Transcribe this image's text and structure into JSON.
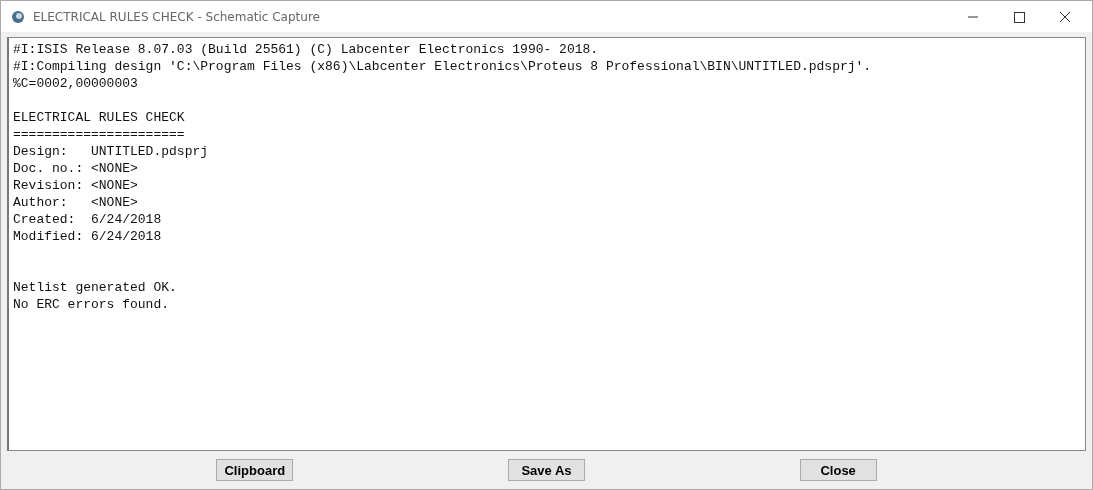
{
  "window": {
    "title": "ELECTRICAL RULES CHECK - Schematic Capture"
  },
  "log_sections": [
    {
      "kind": "header",
      "lines": [
        "#I:ISIS Release 8.07.03 (Build 25561) (C) Labcenter Electronics 1990- 2018.",
        "#I:Compiling design 'C:\\Program Files (x86)\\Labcenter Electronics\\Proteus 8 Professional\\BIN\\UNTITLED.pdsprj'.",
        "%C=0002,00000003"
      ]
    },
    {
      "kind": "report",
      "lines": [
        "ELECTRICAL RULES CHECK",
        "======================",
        "Design:   UNTITLED.pdsprj",
        "Doc. no.: <NONE>",
        "Revision: <NONE>",
        "Author:   <NONE>",
        "Created:  6/24/2018",
        "Modified: 6/24/2018"
      ]
    },
    {
      "kind": "result",
      "lines": [
        "Netlist generated OK.",
        "No ERC errors found."
      ]
    }
  ],
  "buttons": [
    "Clipboard",
    "Save As",
    "Close"
  ]
}
